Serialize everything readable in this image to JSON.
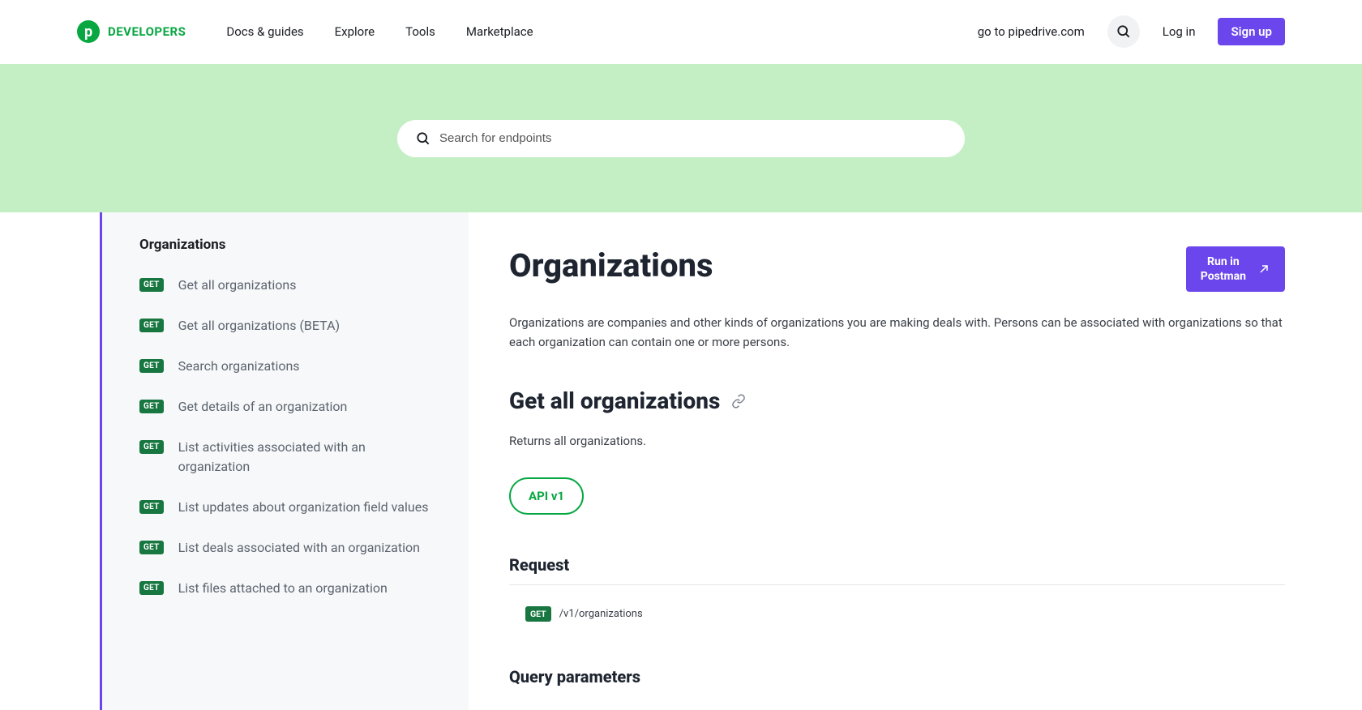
{
  "header": {
    "logo_text": "DEVELOPERS",
    "nav": [
      "Docs & guides",
      "Explore",
      "Tools",
      "Marketplace"
    ],
    "goto_label": "go to pipedrive.com",
    "login_label": "Log in",
    "signup_label": "Sign up"
  },
  "search": {
    "placeholder": "Search for endpoints"
  },
  "sidebar": {
    "title": "Organizations",
    "items": [
      {
        "method": "GET",
        "label": "Get all organizations"
      },
      {
        "method": "GET",
        "label": "Get all organizations (BETA)"
      },
      {
        "method": "GET",
        "label": "Search organizations"
      },
      {
        "method": "GET",
        "label": "Get details of an organization"
      },
      {
        "method": "GET",
        "label": "List activities associated with an organization"
      },
      {
        "method": "GET",
        "label": "List updates about organization field values"
      },
      {
        "method": "GET",
        "label": "List deals associated with an organization"
      },
      {
        "method": "GET",
        "label": "List files attached to an organization"
      }
    ]
  },
  "main": {
    "title": "Organizations",
    "postman_label": "Run in\nPostman",
    "description": "Organizations are companies and other kinds of organizations you are making deals with. Persons can be associated with organizations so that each organization can contain one or more persons.",
    "section_title": "Get all organizations",
    "section_desc": "Returns all organizations.",
    "api_version_label": "API v1",
    "request_title": "Request",
    "request_method": "GET",
    "request_path": "/v1/organizations",
    "query_params_title": "Query parameters"
  }
}
